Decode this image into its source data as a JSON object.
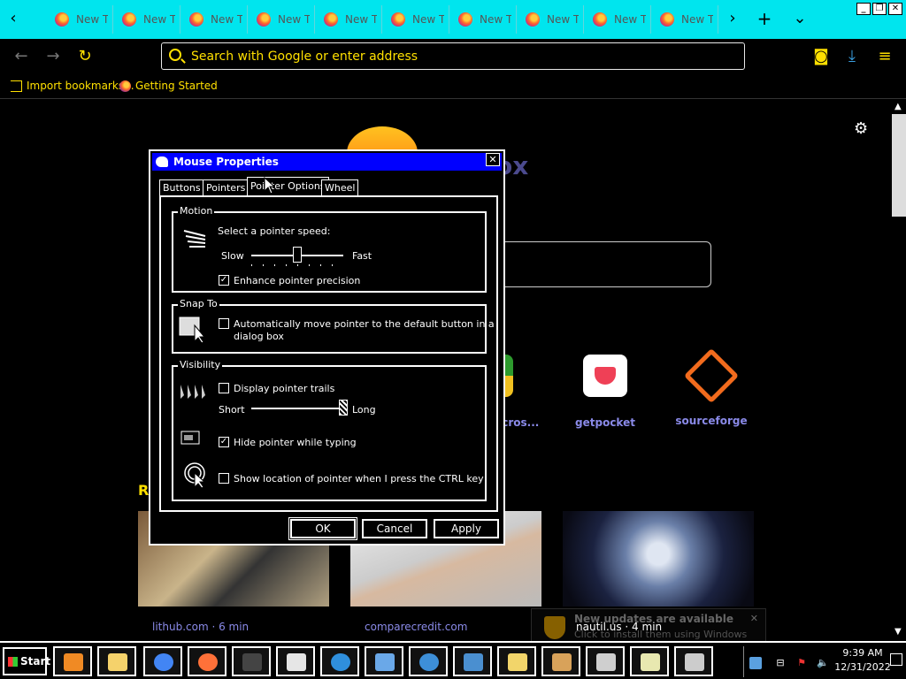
{
  "browser": {
    "tab_label": "New T",
    "tab_count": 10,
    "window_controls": {
      "minimize": "_",
      "maximize": "❐",
      "close": "✕"
    },
    "urlbar_placeholder": "Search with Google or enter address",
    "bookmarks": [
      {
        "label": "Import bookmarks...",
        "icon": "import-icon"
      },
      {
        "label": "Getting Started",
        "icon": "firefox-icon"
      }
    ]
  },
  "page": {
    "logo_text": "ox",
    "shortcuts": [
      {
        "label": "micros...",
        "color": "#2d9a2d"
      },
      {
        "label": "getpocket",
        "color": "#ffffff"
      },
      {
        "label": "sourceforge",
        "color": "#f26b1d"
      }
    ],
    "recommended_heading": "Re",
    "cards": [
      {
        "label": "lithub.com · 6 min"
      },
      {
        "label": "comparecredit.com"
      },
      {
        "label": ""
      }
    ],
    "notification": {
      "title": "New updates are available",
      "body": "Click to install them using Windows Update.",
      "overlay_text": "nautil.us · 4 min"
    }
  },
  "dialog": {
    "title": "Mouse Properties",
    "tabs": [
      "Buttons",
      "Pointers",
      "Pointer Options",
      "Wheel"
    ],
    "active_tab": "Pointer Options",
    "motion": {
      "group_label": "Motion",
      "speed_label": "Select a pointer speed:",
      "slow": "Slow",
      "fast": "Fast",
      "speed_level": 0.5,
      "precision_label": "Enhance pointer precision",
      "precision_checked": true
    },
    "snap_to": {
      "group_label": "Snap To",
      "label_line1": "Automatically move pointer to the default button in a",
      "label_line2": "dialog box",
      "checked": false
    },
    "visibility": {
      "group_label": "Visibility",
      "trails_label": "Display pointer trails",
      "trails_checked": false,
      "short": "Short",
      "long": "Long",
      "trail_length": 1.0,
      "hide_label": "Hide pointer while typing",
      "hide_checked": true,
      "ctrl_label": "Show location of pointer when I press the CTRL key",
      "ctrl_checked": false
    },
    "buttons": {
      "ok": "OK",
      "cancel": "Cancel",
      "apply": "Apply"
    }
  },
  "taskbar": {
    "start_label": "Start",
    "apps": [
      {
        "name": "media-player",
        "color": "#f08a24"
      },
      {
        "name": "file-explorer",
        "color": "#f5d26b"
      },
      {
        "name": "chrome",
        "color": "#4285f4"
      },
      {
        "name": "firefox",
        "color": "#ff7139"
      },
      {
        "name": "mouse",
        "color": "#444444"
      },
      {
        "name": "solitaire",
        "color": "#e6e6e6"
      },
      {
        "name": "internet-globe",
        "color": "#2f8fdc"
      },
      {
        "name": "control-panel",
        "color": "#6aa8e8"
      },
      {
        "name": "network-globe",
        "color": "#3d8fd8"
      },
      {
        "name": "display",
        "color": "#4a8fd0"
      },
      {
        "name": "folder-notes",
        "color": "#f2d56a"
      },
      {
        "name": "paint",
        "color": "#d8a25a"
      },
      {
        "name": "documents",
        "color": "#cfcfcf"
      },
      {
        "name": "notepad",
        "color": "#e8e8b0"
      },
      {
        "name": "mouse-properties",
        "color": "#cccccc"
      }
    ],
    "time": "9:39 AM",
    "date": "12/31/2022"
  }
}
